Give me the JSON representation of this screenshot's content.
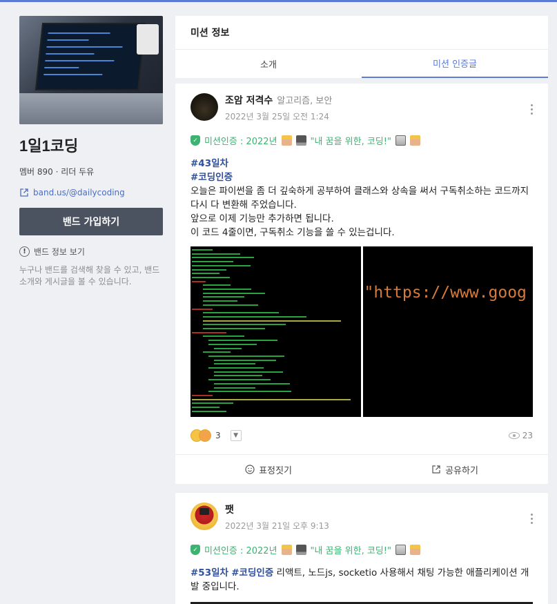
{
  "band": {
    "name": "1일1코딩",
    "meta": "멤버 890 · 리더 두유",
    "link": "band.us/@dailycoding",
    "join_label": "밴드 가입하기",
    "info_label": "밴드 정보 보기",
    "info_desc": "누구나 밴드를 검색해 찾을 수 있고, 밴드 소개와 게시글을 볼 수 있습니다."
  },
  "mission": {
    "title": "미션 정보",
    "tabs": [
      "소개",
      "미션 인증글"
    ],
    "active_tab": 1
  },
  "posts": [
    {
      "author": "조암 저격수",
      "tags": "알고리즘, 보안",
      "date": "2022년 3월 25일 오전 1:24",
      "mission_prefix": "미션인증 : 2022년 ",
      "mission_quote": "\"내 꿈을 위한, 코딩!\"",
      "hash1": "#43",
      "hash1_rest": "일차",
      "hash2": "#코딩인증",
      "lines": [
        "오늘은 파이썬을 좀 더 깊숙하게 공부하여 클래스와 상속을 써서 구독취소하는 코드까지 다시 다 변환해 주었습니다.",
        "앞으로 이제 기능만 추가하면 됩니다.",
        "이 코드 4줄이면, 구독취소 기능을 쓸 수 있는겁니다."
      ],
      "photo2_text": "\"https://www.goog",
      "reaction_count": "3",
      "views": "23",
      "action_emote": "표정짓기",
      "action_share": "공유하기"
    },
    {
      "author": "팻",
      "date": "2022년 3월 21일 오후 9:13",
      "mission_prefix": "미션인증 : 2022년 ",
      "mission_quote": "\"내 꿈을 위한, 코딩!\"",
      "hash1": "#53일차",
      "hash2": "#코딩인증",
      "text": "리액트, 노드js, socketio 사용해서 채팅 가능한 애플리케이션 개발 중입니다."
    }
  ],
  "colors": {
    "accent": "#5b7bd5",
    "mission_green": "#3cb371",
    "join_button": "#4b5260"
  }
}
